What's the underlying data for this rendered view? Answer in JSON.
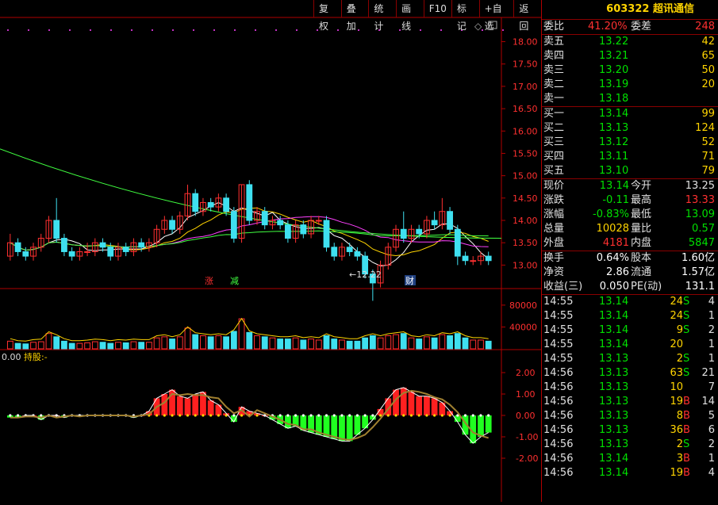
{
  "toolbar": {
    "items": [
      "复权",
      "叠加",
      "统计",
      "画线",
      "F10",
      "标记",
      "+自选",
      "返回"
    ]
  },
  "price_axis": {
    "labels": [
      "18.00",
      "17.50",
      "17.00",
      "16.50",
      "16.00",
      "15.50",
      "15.00",
      "14.50",
      "14.00",
      "13.50",
      "13.00"
    ]
  },
  "vol_axis": {
    "labels": [
      "80000",
      "40000"
    ]
  },
  "ind_axis": {
    "labels": [
      "2.00",
      "1.00",
      "0.00",
      "-1.00",
      "-2.00"
    ]
  },
  "annotations": {
    "low_label": "←12.22",
    "up_mark": "涨",
    "down_mark": "减",
    "fin_mark": "财",
    "ind_value": "0.00",
    "ind_hold": "持股:-"
  },
  "stock": {
    "code": "603322",
    "name": "超讯通信"
  },
  "commission": {
    "ratio_label": "委比",
    "ratio": "41.20%",
    "diff_label": "委差",
    "diff": "248"
  },
  "sells": [
    {
      "label": "卖五",
      "price": "13.22",
      "vol": "42"
    },
    {
      "label": "卖四",
      "price": "13.21",
      "vol": "65"
    },
    {
      "label": "卖三",
      "price": "13.20",
      "vol": "50"
    },
    {
      "label": "卖二",
      "price": "13.19",
      "vol": "20"
    },
    {
      "label": "卖一",
      "price": "13.18",
      "vol": ""
    }
  ],
  "buys": [
    {
      "label": "买一",
      "price": "13.14",
      "vol": "99"
    },
    {
      "label": "买二",
      "price": "13.13",
      "vol": "124"
    },
    {
      "label": "买三",
      "price": "13.12",
      "vol": "52"
    },
    {
      "label": "买四",
      "price": "13.11",
      "vol": "71"
    },
    {
      "label": "买五",
      "price": "13.10",
      "vol": "79"
    }
  ],
  "quote": [
    {
      "l1": "现价",
      "v1": "13.14",
      "c1": "g",
      "l2": "今开",
      "v2": "13.25",
      "c2": "w"
    },
    {
      "l1": "涨跌",
      "v1": "-0.11",
      "c1": "g",
      "l2": "最高",
      "v2": "13.33",
      "c2": "r"
    },
    {
      "l1": "涨幅",
      "v1": "-0.83%",
      "c1": "g",
      "l2": "最低",
      "v2": "13.09",
      "c2": "g"
    },
    {
      "l1": "总量",
      "v1": "10028",
      "c1": "y",
      "l2": "量比",
      "v2": "0.57",
      "c2": "g"
    },
    {
      "l1": "外盘",
      "v1": "4181",
      "c1": "r",
      "l2": "内盘",
      "v2": "5847",
      "c2": "g"
    }
  ],
  "fundamentals": [
    {
      "l1": "换手",
      "v1": "0.64%",
      "l2": "股本",
      "v2": "1.60亿"
    },
    {
      "l1": "净资",
      "v1": "2.86",
      "l2": "流通",
      "v2": "1.57亿"
    },
    {
      "l1": "收益(三)",
      "v1": "0.050",
      "l2": "PE(动)",
      "v2": "131.1"
    }
  ],
  "ticks": [
    {
      "time": "14:55",
      "price": "13.14",
      "vol": "24",
      "dir": "S",
      "num": "4"
    },
    {
      "time": "14:55",
      "price": "13.14",
      "vol": "24",
      "dir": "S",
      "num": "1"
    },
    {
      "time": "14:55",
      "price": "13.14",
      "vol": "9",
      "dir": "S",
      "num": "2"
    },
    {
      "time": "14:55",
      "price": "13.14",
      "vol": "20",
      "dir": "",
      "num": "1"
    },
    {
      "time": "14:55",
      "price": "13.13",
      "vol": "2",
      "dir": "S",
      "num": "1"
    },
    {
      "time": "14:56",
      "price": "13.13",
      "vol": "63",
      "dir": "S",
      "num": "21"
    },
    {
      "time": "14:56",
      "price": "13.13",
      "vol": "10",
      "dir": "",
      "num": "7"
    },
    {
      "time": "14:56",
      "price": "13.13",
      "vol": "19",
      "dir": "B",
      "num": "14"
    },
    {
      "time": "14:56",
      "price": "13.13",
      "vol": "8",
      "dir": "B",
      "num": "5"
    },
    {
      "time": "14:56",
      "price": "13.13",
      "vol": "36",
      "dir": "B",
      "num": "6"
    },
    {
      "time": "14:56",
      "price": "13.13",
      "vol": "2",
      "dir": "S",
      "num": "2"
    },
    {
      "time": "14:56",
      "price": "13.14",
      "vol": "3",
      "dir": "B",
      "num": "1"
    },
    {
      "time": "14:56",
      "price": "13.14",
      "vol": "19",
      "dir": "B",
      "num": "4"
    }
  ],
  "colors": {
    "up": "#ff3030",
    "down": "#3fe0f0",
    "ma1": "#ffffff",
    "ma2": "#ffd400",
    "ma3": "#ff40ff",
    "ma4": "#40ff40",
    "frame": "#b00000"
  },
  "chart_data": {
    "type": "candlestick",
    "ylim": [
      12.9,
      18.4
    ],
    "candles": [
      [
        13.2,
        13.5,
        13.1,
        13.7
      ],
      [
        13.5,
        13.3,
        13.2,
        13.6
      ],
      [
        13.3,
        13.2,
        13.1,
        13.4
      ],
      [
        13.2,
        13.4,
        13.1,
        13.5
      ],
      [
        13.4,
        13.6,
        13.3,
        13.7
      ],
      [
        13.6,
        14.0,
        13.5,
        14.1
      ],
      [
        14.0,
        13.6,
        13.5,
        14.5
      ],
      [
        13.6,
        13.3,
        13.2,
        13.7
      ],
      [
        13.3,
        13.2,
        13.1,
        13.4
      ],
      [
        13.2,
        13.3,
        13.1,
        13.4
      ],
      [
        13.3,
        13.3,
        13.2,
        13.5
      ],
      [
        13.3,
        13.5,
        13.2,
        13.6
      ],
      [
        13.5,
        13.4,
        13.3,
        13.6
      ],
      [
        13.4,
        13.2,
        13.1,
        13.5
      ],
      [
        13.2,
        13.4,
        13.1,
        13.5
      ],
      [
        13.4,
        13.3,
        13.2,
        13.5
      ],
      [
        13.3,
        13.5,
        13.2,
        13.6
      ],
      [
        13.5,
        13.4,
        13.3,
        13.6
      ],
      [
        13.4,
        13.5,
        13.3,
        13.6
      ],
      [
        13.5,
        13.8,
        13.4,
        13.9
      ],
      [
        13.8,
        14.0,
        13.7,
        14.1
      ],
      [
        14.0,
        13.8,
        13.7,
        14.1
      ],
      [
        13.8,
        14.1,
        13.7,
        14.2
      ],
      [
        14.1,
        14.6,
        14.0,
        14.8
      ],
      [
        14.6,
        14.2,
        14.1,
        14.7
      ],
      [
        14.2,
        14.4,
        14.1,
        14.5
      ],
      [
        14.4,
        14.3,
        14.2,
        14.5
      ],
      [
        14.3,
        14.5,
        14.2,
        14.6
      ],
      [
        14.5,
        14.2,
        14.1,
        14.6
      ],
      [
        14.2,
        13.6,
        13.5,
        14.3
      ],
      [
        13.6,
        14.8,
        13.5,
        14.8
      ],
      [
        14.8,
        14.0,
        13.9,
        14.9
      ],
      [
        14.0,
        14.2,
        13.9,
        14.3
      ],
      [
        14.2,
        13.9,
        13.8,
        14.3
      ],
      [
        13.9,
        14.0,
        13.8,
        14.1
      ],
      [
        14.0,
        13.9,
        13.8,
        14.1
      ],
      [
        13.9,
        13.6,
        13.5,
        14.0
      ],
      [
        13.6,
        13.9,
        13.5,
        14.0
      ],
      [
        13.9,
        13.7,
        13.6,
        14.0
      ],
      [
        13.7,
        14.0,
        13.6,
        14.1
      ],
      [
        14.0,
        14.0,
        13.9,
        14.1
      ],
      [
        14.0,
        13.4,
        13.3,
        14.1
      ],
      [
        13.4,
        13.2,
        13.1,
        13.5
      ],
      [
        13.2,
        13.4,
        13.1,
        13.5
      ],
      [
        13.4,
        13.3,
        13.2,
        13.5
      ],
      [
        13.3,
        13.2,
        13.1,
        13.4
      ],
      [
        13.2,
        12.8,
        12.7,
        13.3
      ],
      [
        12.8,
        12.6,
        12.2,
        12.9
      ],
      [
        12.6,
        13.0,
        12.5,
        13.1
      ],
      [
        13.0,
        13.4,
        12.9,
        13.5
      ],
      [
        13.4,
        13.8,
        13.3,
        13.9
      ],
      [
        13.8,
        13.6,
        13.5,
        14.2
      ],
      [
        13.6,
        13.8,
        13.5,
        13.9
      ],
      [
        13.8,
        13.7,
        13.6,
        13.9
      ],
      [
        13.7,
        14.0,
        13.6,
        14.1
      ],
      [
        14.0,
        13.9,
        13.8,
        14.2
      ],
      [
        13.9,
        14.2,
        13.8,
        14.5
      ],
      [
        14.2,
        13.8,
        13.7,
        14.3
      ],
      [
        13.8,
        13.2,
        13.0,
        13.9
      ],
      [
        13.2,
        13.1,
        13.0,
        13.3
      ],
      [
        13.1,
        13.1,
        13.0,
        13.2
      ],
      [
        13.1,
        13.2,
        13.0,
        13.3
      ],
      [
        13.2,
        13.1,
        13.0,
        13.3
      ]
    ],
    "volumes": [
      14,
      10,
      9,
      12,
      13,
      28,
      22,
      14,
      10,
      10,
      11,
      13,
      12,
      10,
      12,
      11,
      13,
      12,
      12,
      20,
      22,
      18,
      22,
      38,
      26,
      24,
      22,
      24,
      22,
      32,
      55,
      30,
      24,
      22,
      20,
      18,
      18,
      20,
      16,
      18,
      16,
      24,
      18,
      16,
      14,
      14,
      20,
      24,
      20,
      24,
      26,
      28,
      20,
      18,
      22,
      20,
      26,
      24,
      28,
      20,
      16,
      16,
      14
    ],
    "indicator": [
      -0.1,
      -0.1,
      0,
      0,
      -0.2,
      0,
      0,
      -0.1,
      0,
      0,
      0,
      0,
      0,
      0,
      0,
      0,
      -0.1,
      0,
      0.2,
      0.8,
      1.0,
      1.2,
      0.9,
      0.8,
      1.0,
      1.1,
      0.7,
      0.5,
      0.1,
      -0.3,
      0.4,
      0.2,
      0.1,
      0,
      -0.2,
      -0.4,
      -0.6,
      -0.5,
      -0.7,
      -0.8,
      -0.9,
      -1.0,
      -1.1,
      -1.2,
      -1.2,
      -0.9,
      -0.6,
      -0.2,
      0.3,
      0.8,
      1.2,
      1.3,
      1.1,
      0.9,
      0.9,
      0.8,
      0.6,
      0.2,
      -0.3,
      -0.9,
      -1.3,
      -1.0,
      -0.8
    ]
  }
}
